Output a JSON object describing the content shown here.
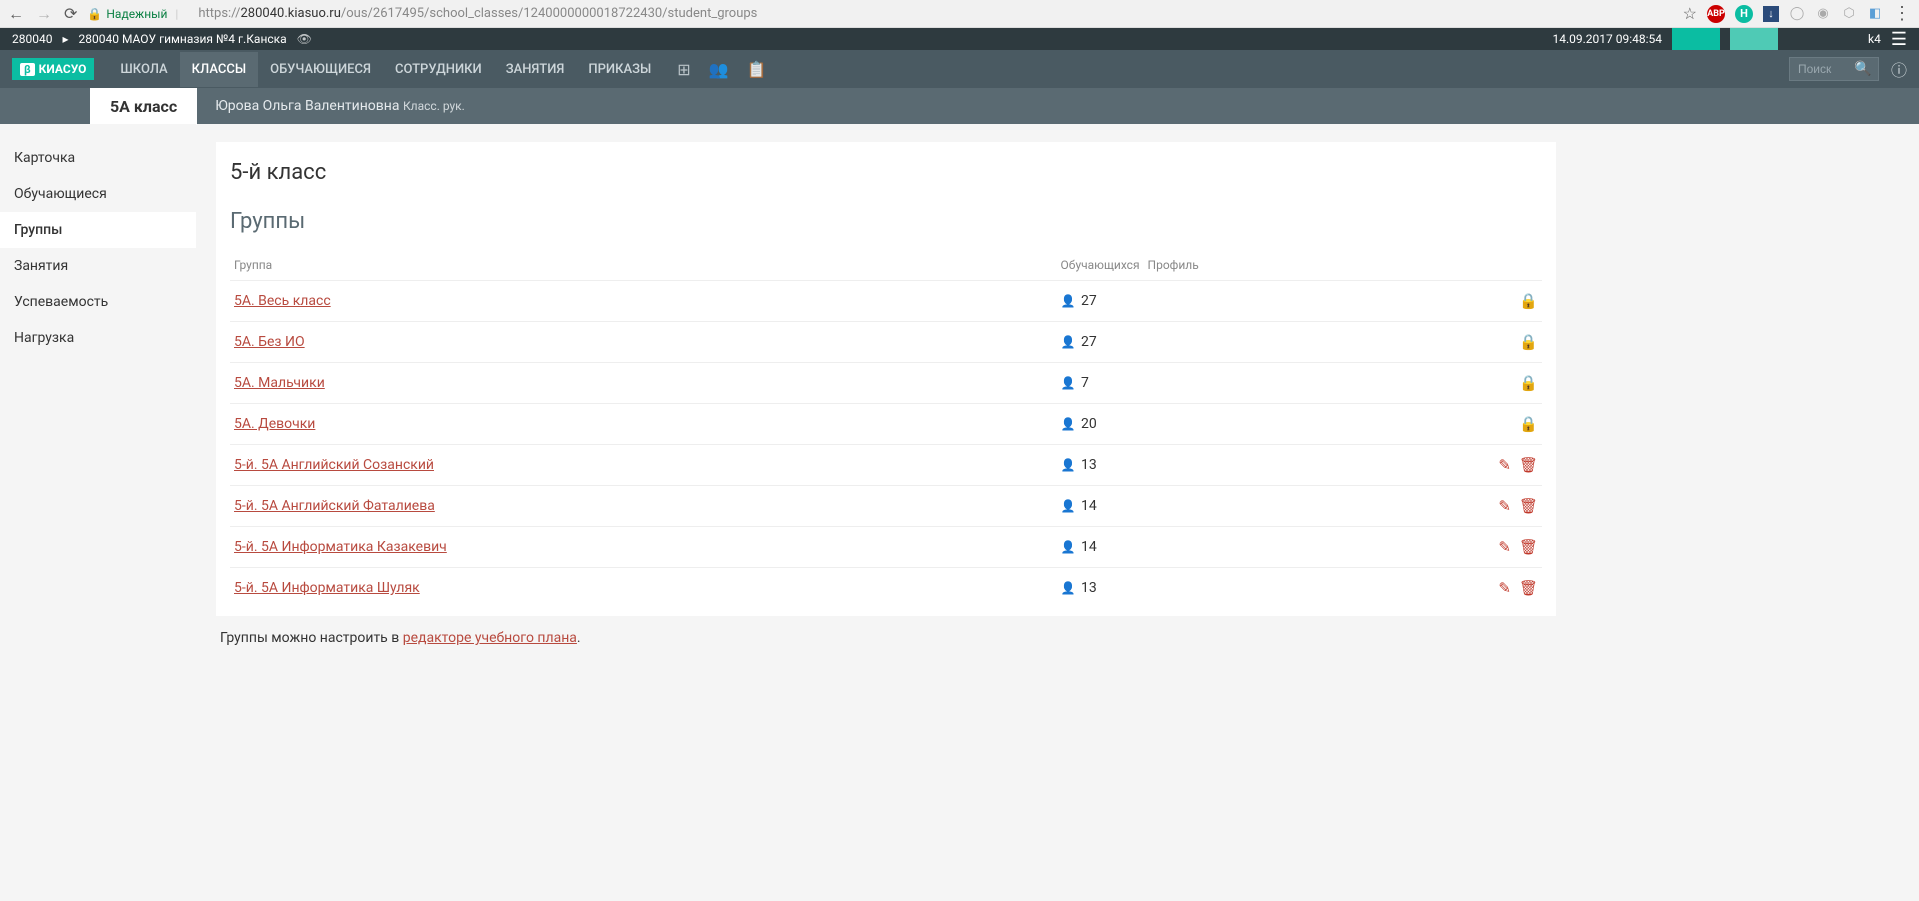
{
  "browser": {
    "security": "Надежный",
    "url_prefix": "https://",
    "url_host": "280040.kiasuo.ru",
    "url_path": "/ous/2617495/school_classes/1240000000018722430/student_groups"
  },
  "topbar": {
    "code": "280040",
    "school": "280040 МАОУ гимназия №4 г.Канска",
    "datetime": "14.09.2017 09:48:54",
    "user": "k4"
  },
  "logo": {
    "beta": "β",
    "text": "КИАСУО"
  },
  "nav": {
    "items": [
      "ШКОЛА",
      "КЛАССЫ",
      "ОБУЧАЮЩИЕСЯ",
      "СОТРУДНИКИ",
      "ЗАНЯТИЯ",
      "ПРИКАЗЫ"
    ],
    "active_index": 1,
    "search_placeholder": "Поиск"
  },
  "subheader": {
    "class_name": "5А класс",
    "teacher_name": "Юрова Ольга Валентиновна",
    "teacher_role": "Класс. рук."
  },
  "sidebar": {
    "items": [
      "Карточка",
      "Обучающиеся",
      "Группы",
      "Занятия",
      "Успеваемость",
      "Нагрузка"
    ],
    "active_index": 2
  },
  "content": {
    "title": "5-й класс",
    "section": "Группы",
    "columns": {
      "group": "Группа",
      "students": "Обучающихся",
      "profile": "Профиль"
    },
    "groups": [
      {
        "name": "5А. Весь класс",
        "count": 27,
        "locked": true
      },
      {
        "name": "5А. Без ИО",
        "count": 27,
        "locked": true
      },
      {
        "name": "5А. Мальчики",
        "count": 7,
        "locked": true
      },
      {
        "name": "5А. Девочки",
        "count": 20,
        "locked": true
      },
      {
        "name": "5-й. 5А Английский Созанский",
        "count": 13,
        "locked": false
      },
      {
        "name": "5-й. 5А Английский Фаталиева",
        "count": 14,
        "locked": false
      },
      {
        "name": "5-й. 5А Информатика Казакевич",
        "count": 14,
        "locked": false
      },
      {
        "name": "5-й. 5А Информатика Шуляк",
        "count": 13,
        "locked": false
      }
    ],
    "footer_prefix": "Группы можно настроить в ",
    "footer_link": "редакторе учебного плана",
    "footer_suffix": "."
  }
}
